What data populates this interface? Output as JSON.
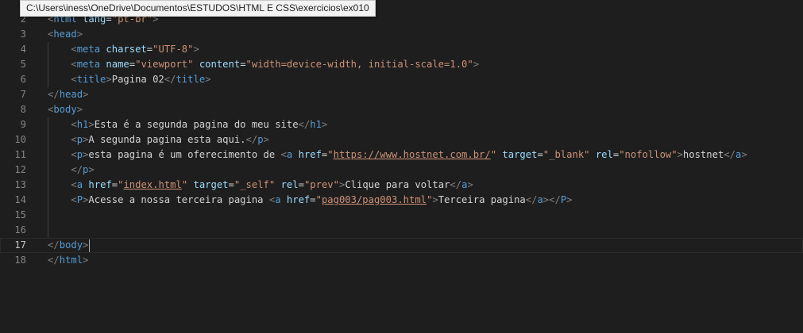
{
  "tooltip": {
    "path": "C:\\Users\\iness\\OneDrive\\Documentos\\ESTUDOS\\HTML E CSS\\exercicios\\ex010"
  },
  "editor": {
    "current_line": 17,
    "lines": [
      {
        "num": "2",
        "indent": 0,
        "tokens": [
          [
            "b",
            "<"
          ],
          [
            "t",
            "html"
          ],
          [
            "x",
            " "
          ],
          [
            "a",
            "lang"
          ],
          [
            "x",
            "="
          ],
          [
            "s",
            "\"pt-br\""
          ],
          [
            "b",
            ">"
          ]
        ]
      },
      {
        "num": "3",
        "indent": 0,
        "tokens": [
          [
            "b",
            "<"
          ],
          [
            "t",
            "head"
          ],
          [
            "b",
            ">"
          ]
        ]
      },
      {
        "num": "4",
        "indent": 1,
        "tokens": [
          [
            "b",
            "<"
          ],
          [
            "t",
            "meta"
          ],
          [
            "x",
            " "
          ],
          [
            "a",
            "charset"
          ],
          [
            "x",
            "="
          ],
          [
            "s",
            "\"UTF-8\""
          ],
          [
            "b",
            ">"
          ]
        ]
      },
      {
        "num": "5",
        "indent": 1,
        "tokens": [
          [
            "b",
            "<"
          ],
          [
            "t",
            "meta"
          ],
          [
            "x",
            " "
          ],
          [
            "a",
            "name"
          ],
          [
            "x",
            "="
          ],
          [
            "s",
            "\"viewport\""
          ],
          [
            "x",
            " "
          ],
          [
            "a",
            "content"
          ],
          [
            "x",
            "="
          ],
          [
            "s",
            "\"width=device-width, initial-scale=1.0\""
          ],
          [
            "b",
            ">"
          ]
        ]
      },
      {
        "num": "6",
        "indent": 1,
        "tokens": [
          [
            "b",
            "<"
          ],
          [
            "t",
            "title"
          ],
          [
            "b",
            ">"
          ],
          [
            "x",
            "Pagina 02"
          ],
          [
            "b",
            "</"
          ],
          [
            "t",
            "title"
          ],
          [
            "b",
            ">"
          ]
        ]
      },
      {
        "num": "7",
        "indent": 0,
        "tokens": [
          [
            "b",
            "</"
          ],
          [
            "t",
            "head"
          ],
          [
            "b",
            ">"
          ]
        ]
      },
      {
        "num": "8",
        "indent": 0,
        "tokens": [
          [
            "b",
            "<"
          ],
          [
            "t",
            "body"
          ],
          [
            "b",
            ">"
          ]
        ]
      },
      {
        "num": "9",
        "indent": 1,
        "tokens": [
          [
            "b",
            "<"
          ],
          [
            "t",
            "h1"
          ],
          [
            "b",
            ">"
          ],
          [
            "x",
            "Esta é a segunda pagina do meu site"
          ],
          [
            "b",
            "</"
          ],
          [
            "t",
            "h1"
          ],
          [
            "b",
            ">"
          ]
        ]
      },
      {
        "num": "10",
        "indent": 1,
        "tokens": [
          [
            "b",
            "<"
          ],
          [
            "t",
            "p"
          ],
          [
            "b",
            ">"
          ],
          [
            "x",
            "A segunda pagina esta aqui."
          ],
          [
            "b",
            "</"
          ],
          [
            "t",
            "p"
          ],
          [
            "b",
            ">"
          ]
        ]
      },
      {
        "num": "11",
        "indent": 1,
        "tokens": [
          [
            "b",
            "<"
          ],
          [
            "t",
            "p"
          ],
          [
            "b",
            ">"
          ],
          [
            "x",
            "esta pagina é um oferecimento de "
          ],
          [
            "b",
            "<"
          ],
          [
            "t",
            "a"
          ],
          [
            "x",
            " "
          ],
          [
            "a",
            "href"
          ],
          [
            "x",
            "="
          ],
          [
            "s",
            "\""
          ],
          [
            "u",
            "https://www.hostnet.com.br/"
          ],
          [
            "s",
            "\""
          ],
          [
            "x",
            " "
          ],
          [
            "a",
            "target"
          ],
          [
            "x",
            "="
          ],
          [
            "s",
            "\"_blank\""
          ],
          [
            "x",
            " "
          ],
          [
            "a",
            "rel"
          ],
          [
            "x",
            "="
          ],
          [
            "s",
            "\"nofollow\""
          ],
          [
            "b",
            ">"
          ],
          [
            "x",
            "hostnet"
          ],
          [
            "b",
            "</"
          ],
          [
            "t",
            "a"
          ],
          [
            "b",
            ">"
          ]
        ]
      },
      {
        "num": "12",
        "indent": 1,
        "tokens": [
          [
            "b",
            "</"
          ],
          [
            "t",
            "p"
          ],
          [
            "b",
            ">"
          ]
        ]
      },
      {
        "num": "13",
        "indent": 1,
        "tokens": [
          [
            "b",
            "<"
          ],
          [
            "t",
            "a"
          ],
          [
            "x",
            " "
          ],
          [
            "a",
            "href"
          ],
          [
            "x",
            "="
          ],
          [
            "s",
            "\""
          ],
          [
            "u",
            "index.html"
          ],
          [
            "s",
            "\""
          ],
          [
            "x",
            " "
          ],
          [
            "a",
            "target"
          ],
          [
            "x",
            "="
          ],
          [
            "s",
            "\"_self\""
          ],
          [
            "x",
            " "
          ],
          [
            "a",
            "rel"
          ],
          [
            "x",
            "="
          ],
          [
            "s",
            "\"prev\""
          ],
          [
            "b",
            ">"
          ],
          [
            "x",
            "Clique para voltar"
          ],
          [
            "b",
            "</"
          ],
          [
            "t",
            "a"
          ],
          [
            "b",
            ">"
          ]
        ]
      },
      {
        "num": "14",
        "indent": 1,
        "tokens": [
          [
            "b",
            "<"
          ],
          [
            "t",
            "P"
          ],
          [
            "b",
            ">"
          ],
          [
            "x",
            "Acesse a nossa terceira pagina "
          ],
          [
            "b",
            "<"
          ],
          [
            "t",
            "a"
          ],
          [
            "x",
            " "
          ],
          [
            "a",
            "href"
          ],
          [
            "x",
            "="
          ],
          [
            "s",
            "\""
          ],
          [
            "u",
            "pag003/pag003.html"
          ],
          [
            "s",
            "\""
          ],
          [
            "b",
            ">"
          ],
          [
            "x",
            "Terceira pagina"
          ],
          [
            "b",
            "</"
          ],
          [
            "t",
            "a"
          ],
          [
            "b",
            "></"
          ],
          [
            "t",
            "P"
          ],
          [
            "b",
            ">"
          ]
        ]
      },
      {
        "num": "15",
        "indent": 1,
        "tokens": []
      },
      {
        "num": "16",
        "indent": 1,
        "tokens": []
      },
      {
        "num": "17",
        "indent": 0,
        "tokens": [
          [
            "b",
            "</"
          ],
          [
            "t",
            "body"
          ],
          [
            "b",
            ">"
          ]
        ]
      },
      {
        "num": "18",
        "indent": 0,
        "tokens": [
          [
            "b",
            "</"
          ],
          [
            "t",
            "html"
          ],
          [
            "b",
            ">"
          ]
        ]
      }
    ]
  }
}
